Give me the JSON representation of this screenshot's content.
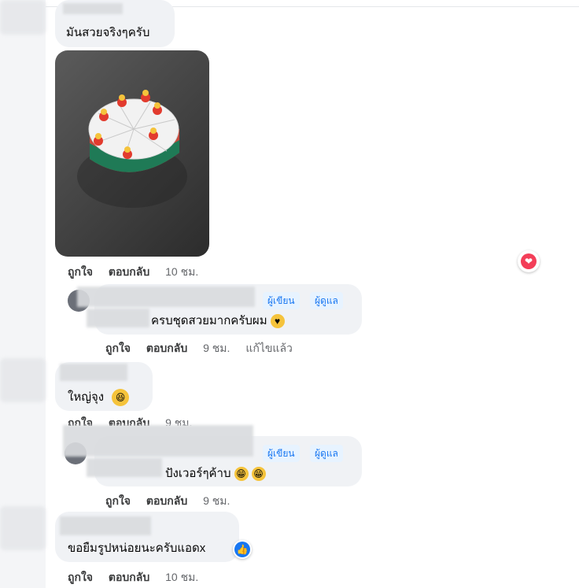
{
  "comments": [
    {
      "text": "มันสวยจริงๆครับ",
      "actions": {
        "like": "ถูกใจ",
        "reply": "ตอบกลับ",
        "time": "10 ชม."
      }
    },
    {
      "badges": [
        "ผู้เขียน",
        "ผู้ดูแล"
      ],
      "text": "ครบชุดสวยมากครับผม",
      "actions": {
        "like": "ถูกใจ",
        "reply": "ตอบกลับ",
        "time": "9 ชม.",
        "edited": "แก้ไขแล้ว"
      }
    },
    {
      "text": "ใหญ่จุง",
      "actions": {
        "like": "ถูกใจ",
        "reply": "ตอบกลับ",
        "time": "9 ชม."
      }
    },
    {
      "badges": [
        "ผู้เขียน",
        "ผู้ดูแล"
      ],
      "text": "ปังเวอร์ๆค้าบ",
      "actions": {
        "like": "ถูกใจ",
        "reply": "ตอบกลับ",
        "time": "9 ชม."
      }
    },
    {
      "text": "ขอยืมรูปหน่อยนะครับแอดx",
      "actions": {
        "like": "ถูกใจ",
        "reply": "ตอบกลับ",
        "time": "10 ชม."
      }
    }
  ],
  "photo": {
    "subject": "cake-shaped toy with figurines"
  },
  "reactions": {
    "love": "heart-icon",
    "like": "thumbs-up-icon"
  },
  "colors": {
    "accent": "#1877f2",
    "love": "#f33e58",
    "bubble": "#f0f2f5"
  }
}
